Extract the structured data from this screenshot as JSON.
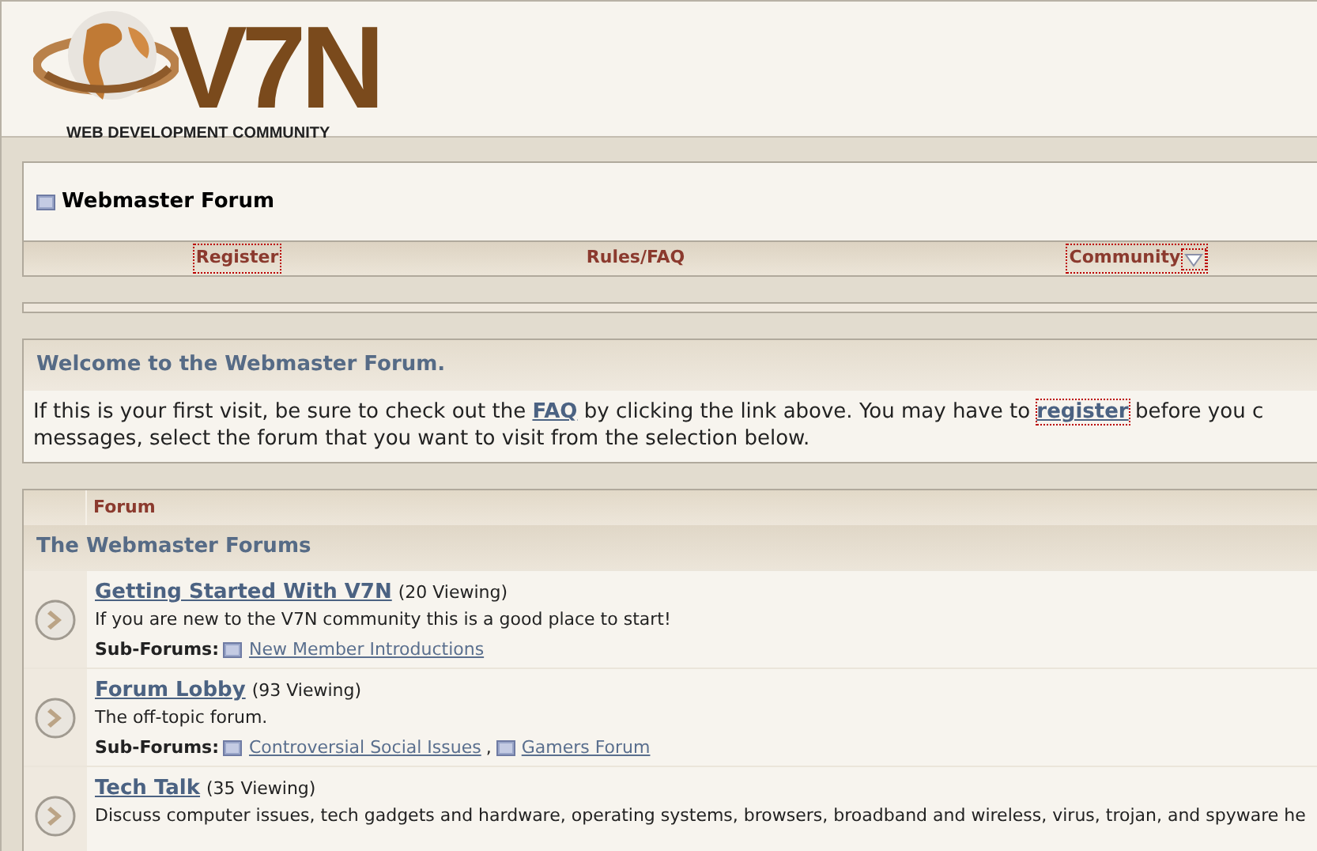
{
  "logo": {
    "mark": "V7N",
    "tagline": "WEB DEVELOPMENT COMMUNITY"
  },
  "forum_title": "Webmaster Forum",
  "nav": [
    {
      "label": "Register",
      "focused": true,
      "menu": false
    },
    {
      "label": "Rules/FAQ",
      "focused": false,
      "menu": false
    },
    {
      "label": "Community",
      "focused": true,
      "menu": true
    }
  ],
  "welcome": {
    "title": "Welcome to the Webmaster Forum.",
    "text_1": "If this is your first visit, be sure to check out the ",
    "faq_link": "FAQ",
    "text_2": " by clicking the link above. You may have to ",
    "register_link": "register",
    "text_3": " before you c",
    "line_2": "messages, select the forum that you want to visit from the selection below."
  },
  "table": {
    "column_header": "Forum",
    "category": "The Webmaster Forums",
    "rows": [
      {
        "title": "Getting Started With V7N",
        "viewing": "(20 Viewing)",
        "description": "If you are new to the V7N community this is a good place to start!",
        "subforums_label": "Sub-Forums:",
        "subforums": [
          "New Member Introductions"
        ]
      },
      {
        "title": "Forum Lobby",
        "viewing": "(93 Viewing)",
        "description": "The off-topic forum.",
        "subforums_label": "Sub-Forums:",
        "separator": ",",
        "subforums": [
          "Controversial Social Issues",
          "Gamers Forum"
        ]
      },
      {
        "title": "Tech Talk",
        "viewing": "(35 Viewing)",
        "description": "Discuss computer issues, tech gadgets and hardware, operating systems, browsers, broadband and wireless, virus, trojan, and spyware he"
      }
    ]
  }
}
